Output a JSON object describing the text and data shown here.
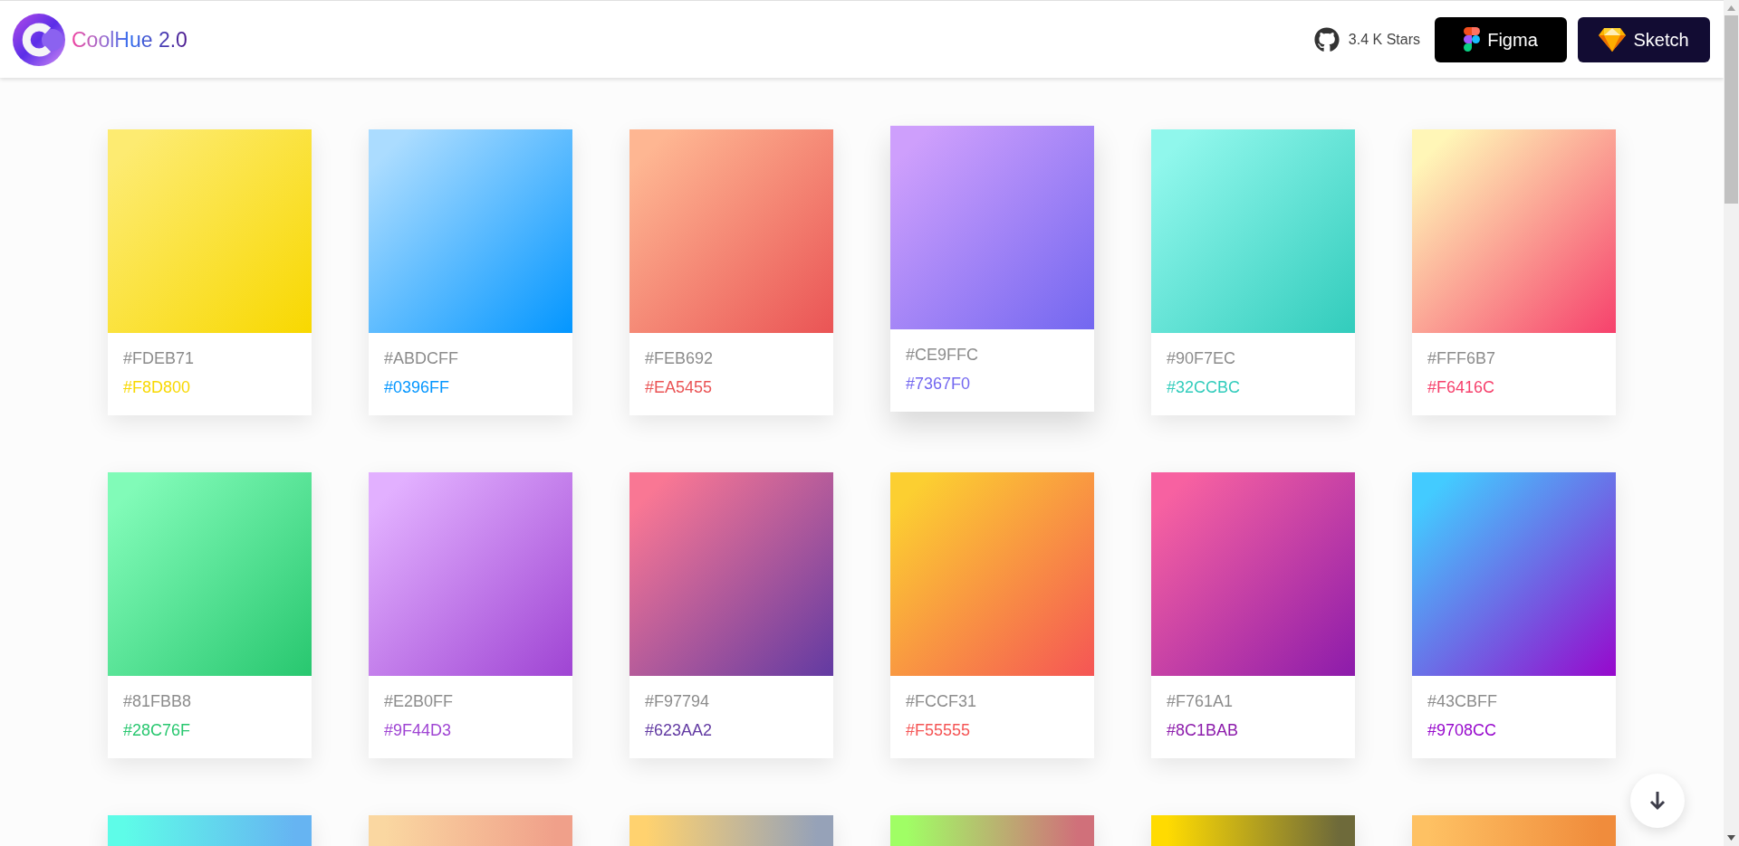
{
  "header": {
    "logo_text": "CoolHue 2.0",
    "stars": "3.4 K Stars",
    "buttons": [
      {
        "label": "Figma",
        "kind": "figma"
      },
      {
        "label": "Sketch",
        "kind": "sketch"
      }
    ]
  },
  "palettes": [
    {
      "start": "#FDEB71",
      "end": "#F8D800",
      "hovered": false
    },
    {
      "start": "#ABDCFF",
      "end": "#0396FF",
      "hovered": false
    },
    {
      "start": "#FEB692",
      "end": "#EA5455",
      "hovered": false
    },
    {
      "start": "#CE9FFC",
      "end": "#7367F0",
      "hovered": true
    },
    {
      "start": "#90F7EC",
      "end": "#32CCBC",
      "hovered": false
    },
    {
      "start": "#FFF6B7",
      "end": "#F6416C",
      "hovered": false
    },
    {
      "start": "#81FBB8",
      "end": "#28C76F",
      "hovered": false
    },
    {
      "start": "#E2B0FF",
      "end": "#9F44D3",
      "hovered": false
    },
    {
      "start": "#F97794",
      "end": "#623AA2",
      "hovered": false
    },
    {
      "start": "#FCCF31",
      "end": "#F55555",
      "hovered": false
    },
    {
      "start": "#F761A1",
      "end": "#8C1BAB",
      "hovered": false
    },
    {
      "start": "#43CBFF",
      "end": "#9708CC",
      "hovered": false
    }
  ],
  "partial_palettes": [
    {
      "stops": [
        {
          "color": "#5efce8"
        },
        {
          "color": "#66b4f2"
        }
      ]
    },
    {
      "stops": [
        {
          "color": "#fad7a1"
        },
        {
          "color": "#f0a08a"
        }
      ]
    },
    {
      "stops": [
        {
          "color": "#ffd26f"
        },
        {
          "color": "#96a2b8"
        }
      ]
    },
    {
      "stops": [
        {
          "color": "#a0fe65"
        },
        {
          "color": "#d0707a"
        }
      ]
    },
    {
      "stops": [
        {
          "color": "#ffdb01"
        },
        {
          "color": "#6e6a3a"
        }
      ]
    },
    {
      "stops": [
        {
          "color": "#fec163"
        },
        {
          "color": "#f08c3c"
        }
      ]
    }
  ]
}
